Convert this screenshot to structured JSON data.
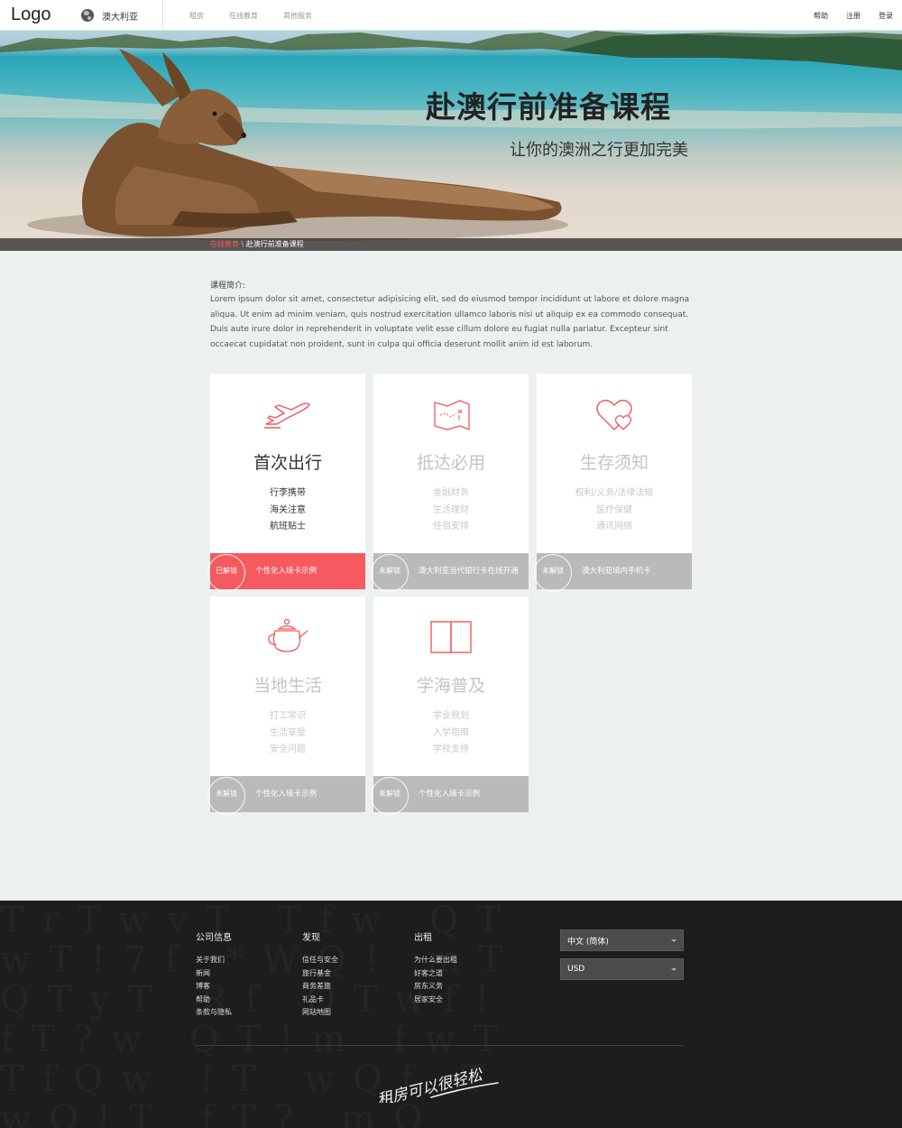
{
  "header": {
    "logo": "Logo",
    "region": "澳大利亚",
    "nav": [
      "租房",
      "在线教育",
      "其他服务"
    ],
    "user_nav": [
      "帮助",
      "注册",
      "登录"
    ]
  },
  "hero": {
    "title": "赴澳行前准备课程",
    "subtitle": "让你的澳洲之行更加完美",
    "breadcrumb": {
      "link": "在线教育",
      "separator": " \\ ",
      "current": "赴澳行前准备课程"
    }
  },
  "intro": {
    "title": "课程简介:",
    "text": "Lorem ipsum dolor sit amet, consectetur adipisicing elit, sed do eiusmod tempor incididunt ut labore et dolore magna aliqua. Ut enim ad minim veniam, quis nostrud exercitation ullamco laboris nisi ut aliquip ex ea commodo consequat. Duis aute irure dolor in reprehenderit in voluptate velit esse cillum dolore eu fugiat nulla pariatur. Excepteur sint occaecat cupidatat non proident, sunt in culpa qui officia deserunt mollit anim id est laborum."
  },
  "cards": [
    {
      "title": "首次出行",
      "items": [
        "行李携带",
        "海关注意",
        "航班贴士"
      ],
      "badge": "已解锁",
      "footer": "个性化入境卡示例",
      "icon": "airplane-icon",
      "unlocked": true
    },
    {
      "title": "抵达必用",
      "items": [
        "金融财务",
        "生活理财",
        "住宿安排"
      ],
      "badge": "未解锁",
      "footer": "澳大利亚当代银行卡在线开通",
      "icon": "map-icon",
      "unlocked": false
    },
    {
      "title": "生存须知",
      "items": [
        "权利/义务/法律法规",
        "医疗保健",
        "通讯网络"
      ],
      "badge": "未解锁",
      "footer": "澳大利亚境内手机卡",
      "icon": "hearts-icon",
      "unlocked": false
    },
    {
      "title": "当地生活",
      "items": [
        "打工常识",
        "生活享受",
        "安全问题"
      ],
      "badge": "未解锁",
      "footer": "个性化入境卡示例",
      "icon": "teapot-icon",
      "unlocked": false
    },
    {
      "title": "学海普及",
      "items": [
        "学业规划",
        "入学指南",
        "学校支持"
      ],
      "badge": "未解锁",
      "footer": "个性化入境卡示例",
      "icon": "book-icon",
      "unlocked": false
    }
  ],
  "footer": {
    "columns": [
      {
        "title": "公司信息",
        "links": [
          "关于我们",
          "新闻",
          "博客",
          "帮助",
          "条款与隐私"
        ]
      },
      {
        "title": "发现",
        "links": [
          "信任与安全",
          "旅行基金",
          "商务差旅",
          "礼品卡",
          "网站地图"
        ]
      },
      {
        "title": "出租",
        "links": [
          "为什么要出租",
          "好客之道",
          "房东义务",
          "居家安全"
        ]
      }
    ],
    "language": "中文 (简体)",
    "currency": "USD",
    "slogan": "租房可以很轻松"
  },
  "colors": {
    "accent": "#f45a60",
    "locked": "#bababa",
    "footer_bg": "#1d1d1d",
    "page_bg": "#edf0f1"
  }
}
